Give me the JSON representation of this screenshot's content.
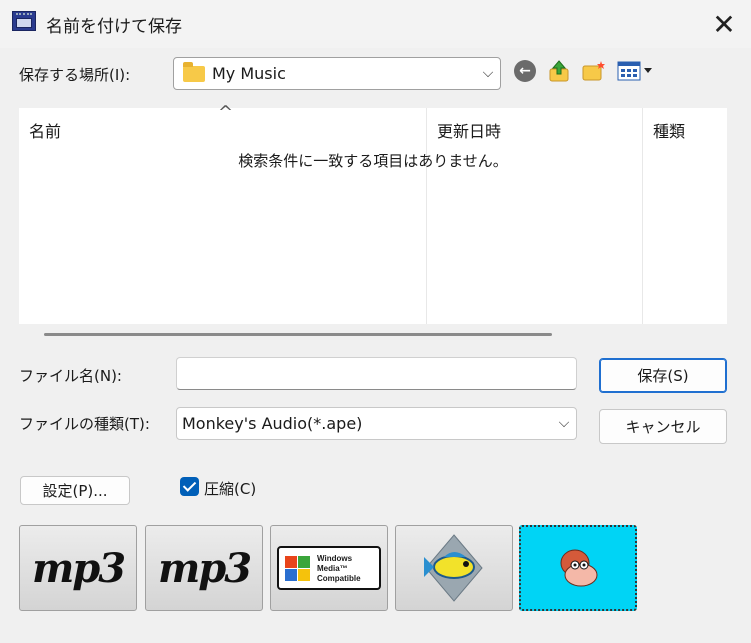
{
  "window": {
    "title": "名前を付けて保存",
    "close_label": "✕"
  },
  "lookin": {
    "label": "保存する場所(I):",
    "value": "My Music"
  },
  "toolbar": {
    "back_glyph": "←"
  },
  "filelist": {
    "columns": [
      "名前",
      "更新日時",
      "種類"
    ],
    "sort_caret": "^",
    "empty_message": "検索条件に一致する項目はありません。"
  },
  "filename": {
    "label": "ファイル名(N):",
    "value": ""
  },
  "filetype": {
    "label": "ファイルの種類(T):",
    "value": "Monkey's Audio(*.ape)"
  },
  "buttons": {
    "save": "保存(S)",
    "cancel": "キャンセル",
    "settings": "設定(P)..."
  },
  "compress": {
    "label": "圧縮(C)",
    "checked": true
  },
  "formats": {
    "mp3_a": "mp3",
    "mp3_b": "mp3",
    "wmp_lines": [
      "Windows",
      "Media™",
      "Compatible"
    ]
  },
  "colors": {
    "accent": "#005fb8",
    "selected_format_bg": "#00d4f5",
    "folder": "#f7c948"
  }
}
